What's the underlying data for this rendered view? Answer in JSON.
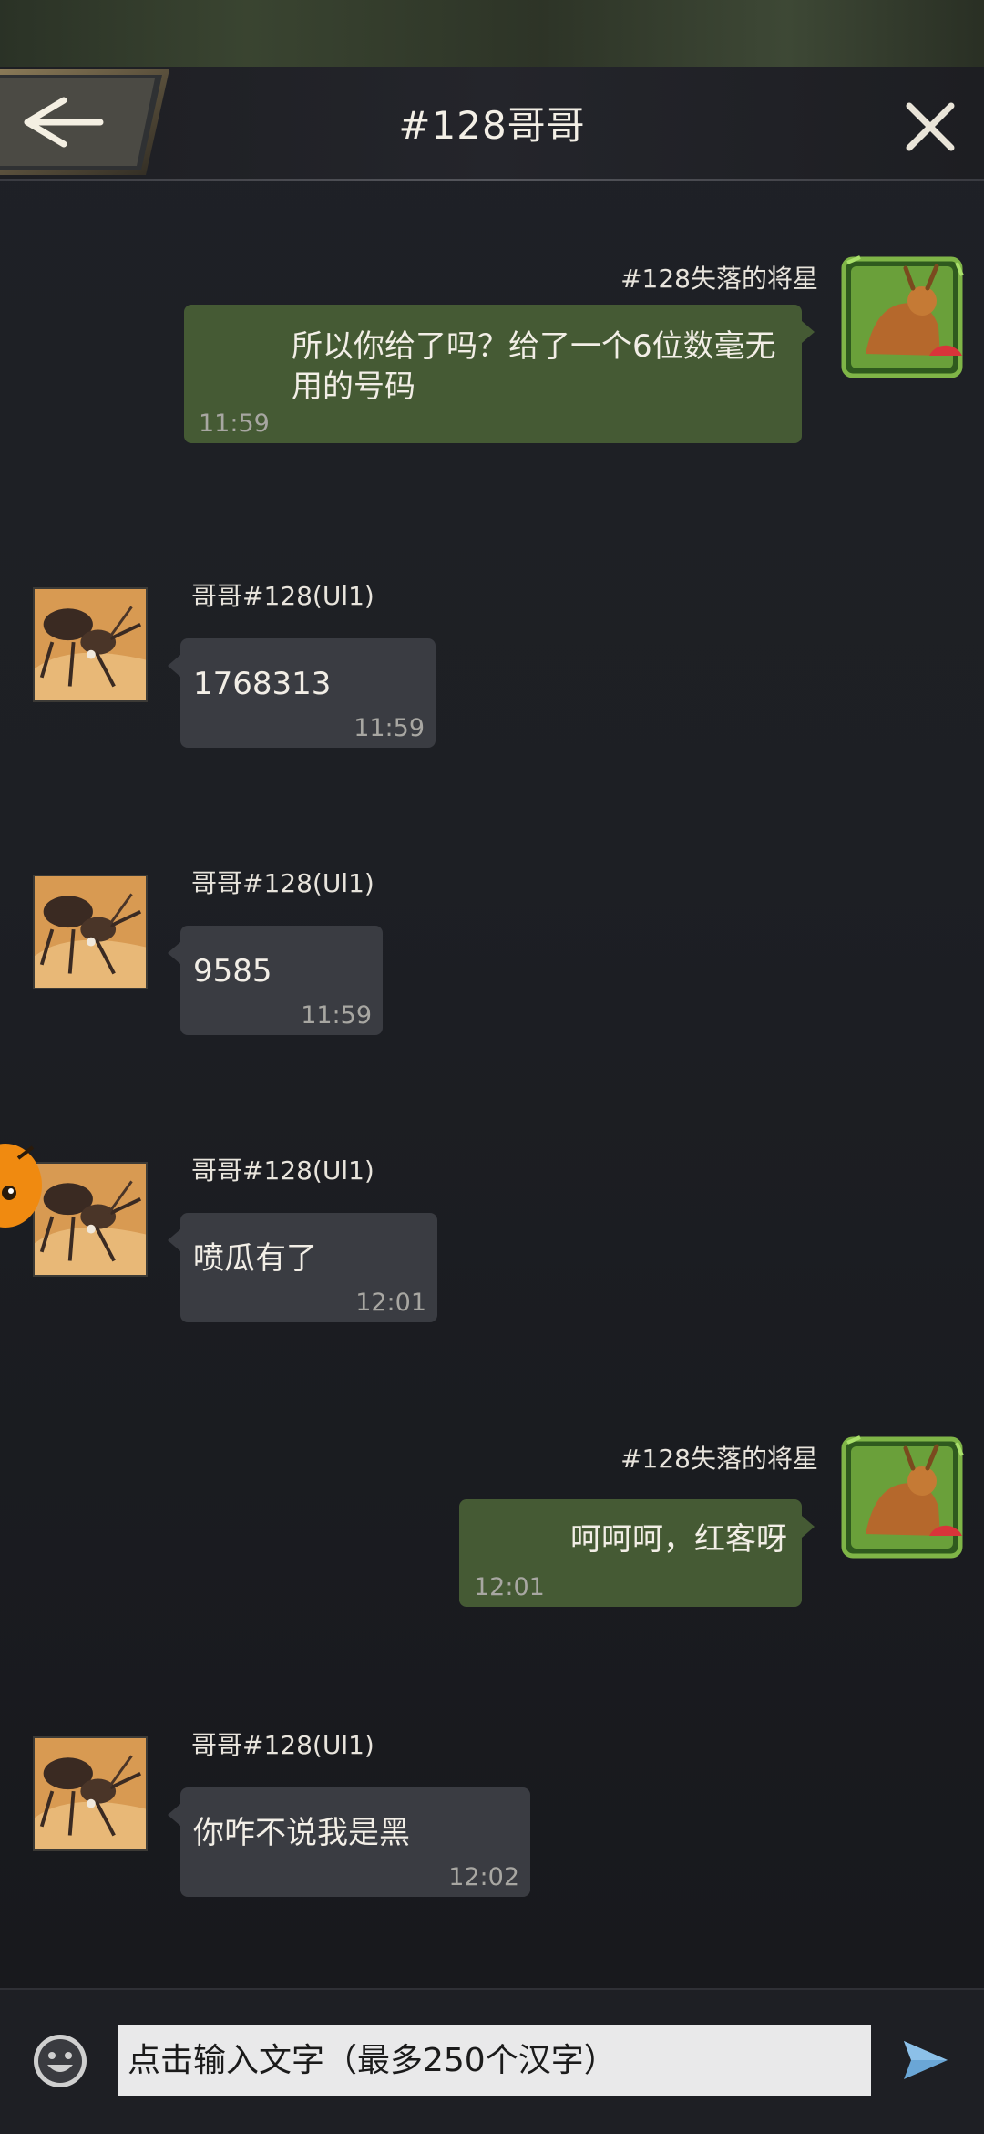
{
  "header": {
    "title": "#128哥哥",
    "back_icon": "back-arrow-icon",
    "close_icon": "close-icon"
  },
  "messages": [
    {
      "side": "out",
      "sender": "#128失落的将星",
      "lines": [
        "所以你给了吗？给了一个6位数毫无",
        "用的号码"
      ],
      "time": "11:59"
    },
    {
      "side": "in",
      "sender": "哥哥#128(Ul1)",
      "lines": [
        "1768313"
      ],
      "time": "11:59"
    },
    {
      "side": "in",
      "sender": "哥哥#128(Ul1)",
      "lines": [
        "9585"
      ],
      "time": "11:59"
    },
    {
      "side": "in",
      "sender": "哥哥#128(Ul1)",
      "lines": [
        "喷瓜有了"
      ],
      "time": "12:01"
    },
    {
      "side": "out",
      "sender": "#128失落的将星",
      "lines": [
        "呵呵呵，红客呀"
      ],
      "time": "12:01"
    },
    {
      "side": "in",
      "sender": "哥哥#128(Ul1)",
      "lines": [
        "你咋不说我是黑"
      ],
      "time": "12:02"
    }
  ],
  "input": {
    "placeholder": "点击输入文字（最多250个汉字）",
    "emoji_icon": "emoji-icon",
    "send_icon": "send-icon"
  },
  "colors": {
    "bubble_in": "#3a3c42",
    "bubble_out": "#455a34",
    "background": "#1d1f24"
  }
}
